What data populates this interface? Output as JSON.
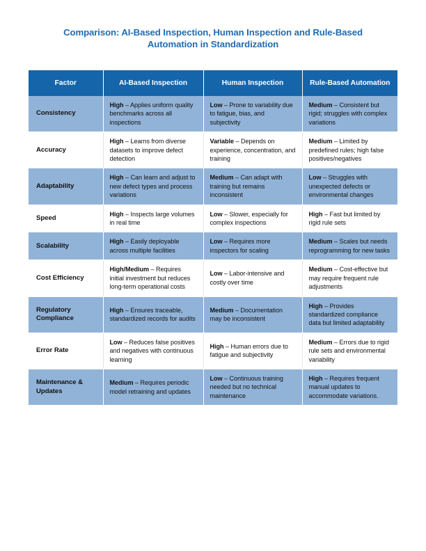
{
  "document": {
    "title": "Comparison: AI-Based Inspection, Human Inspection and Rule-Based Automation in Standardization"
  },
  "colors": {
    "title_blue": "#1f6cb4",
    "header_blue": "#1565ab",
    "row_shaded_blue": "#92b3d8",
    "row_plain": "#ffffff",
    "text": "#111111"
  },
  "table": {
    "columns": [
      {
        "key": "factor",
        "label": "Factor"
      },
      {
        "key": "ai",
        "label": "AI-Based Inspection"
      },
      {
        "key": "human",
        "label": "Human Inspection"
      },
      {
        "key": "rule",
        "label": "Rule-Based Automation"
      }
    ],
    "rows": [
      {
        "factor": "Consistency",
        "shaded": true,
        "ai": {
          "rating": "High",
          "text": " – Applies uniform quality benchmarks across all inspections"
        },
        "human": {
          "rating": "Low",
          "text": " – Prone to variability due to fatigue, bias, and subjectivity"
        },
        "rule": {
          "rating": "Medium",
          "text": " – Consistent but rigid; struggles with complex variations"
        }
      },
      {
        "factor": "Accuracy",
        "shaded": false,
        "ai": {
          "rating": "High",
          "text": " – Learns from diverse datasets to improve defect detection"
        },
        "human": {
          "rating": "Variable",
          "text": " – Depends on experience, concentration, and training"
        },
        "rule": {
          "rating": "Medium",
          "text": " – Limited by predefined rules; high false positives/negatives"
        }
      },
      {
        "factor": "Adaptability",
        "shaded": true,
        "ai": {
          "rating": "High",
          "text": " – Can learn and adjust to new defect types and process variations"
        },
        "human": {
          "rating": "Medium",
          "text": " – Can adapt with training but remains inconsistent"
        },
        "rule": {
          "rating": "Low",
          "text": " – Struggles with unexpected defects or environmental changes"
        }
      },
      {
        "factor": "Speed",
        "shaded": false,
        "ai": {
          "rating": "High",
          "text": " – Inspects large volumes in real time"
        },
        "human": {
          "rating": "Low",
          "text": " – Slower, especially for complex inspections"
        },
        "rule": {
          "rating": "High",
          "text": " – Fast but limited by rigid rule sets"
        }
      },
      {
        "factor": "Scalability",
        "shaded": true,
        "ai": {
          "rating": "High",
          "text": " – Easily deployable across multiple facilities"
        },
        "human": {
          "rating": "Low",
          "text": " – Requires more inspectors for scaling"
        },
        "rule": {
          "rating": "Medium",
          "text": " – Scales but needs reprogramming for new tasks"
        }
      },
      {
        "factor": "Cost Efficiency",
        "shaded": false,
        "ai": {
          "rating": "High/Medium",
          "text": " – Requires initial investment but reduces long-term operational costs"
        },
        "human": {
          "rating": "Low",
          "text": " – Labor-intensive and costly over time"
        },
        "rule": {
          "rating": "Medium",
          "text": " – Cost-effective but may require frequent rule adjustments"
        }
      },
      {
        "factor": "Regulatory Compliance",
        "shaded": true,
        "ai": {
          "rating": "High",
          "text": " – Ensures traceable, standardized records for audits"
        },
        "human": {
          "rating": "Medium",
          "text": " – Documentation may be inconsistent"
        },
        "rule": {
          "rating": "High",
          "text": " – Provides standardized compliance data but limited adaptability"
        }
      },
      {
        "factor": "Error Rate",
        "shaded": false,
        "ai": {
          "rating": "Low",
          "text": " – Reduces false positives and negatives with continuous learning"
        },
        "human": {
          "rating": "High",
          "text": " – Human errors due to fatigue and subjectivity"
        },
        "rule": {
          "rating": "Medium",
          "text": " – Errors due to rigid rule sets and environmental variability"
        }
      },
      {
        "factor": "Maintenance & Updates",
        "shaded": true,
        "ai": {
          "rating": "Medium",
          "text": " – Requires periodic model retraining and updates"
        },
        "human": {
          "rating": "Low",
          "text": " – Continuous training needed but no technical maintenance"
        },
        "rule": {
          "rating": "High",
          "text": " – Requires frequent manual updates to accommodate variations."
        }
      }
    ]
  }
}
